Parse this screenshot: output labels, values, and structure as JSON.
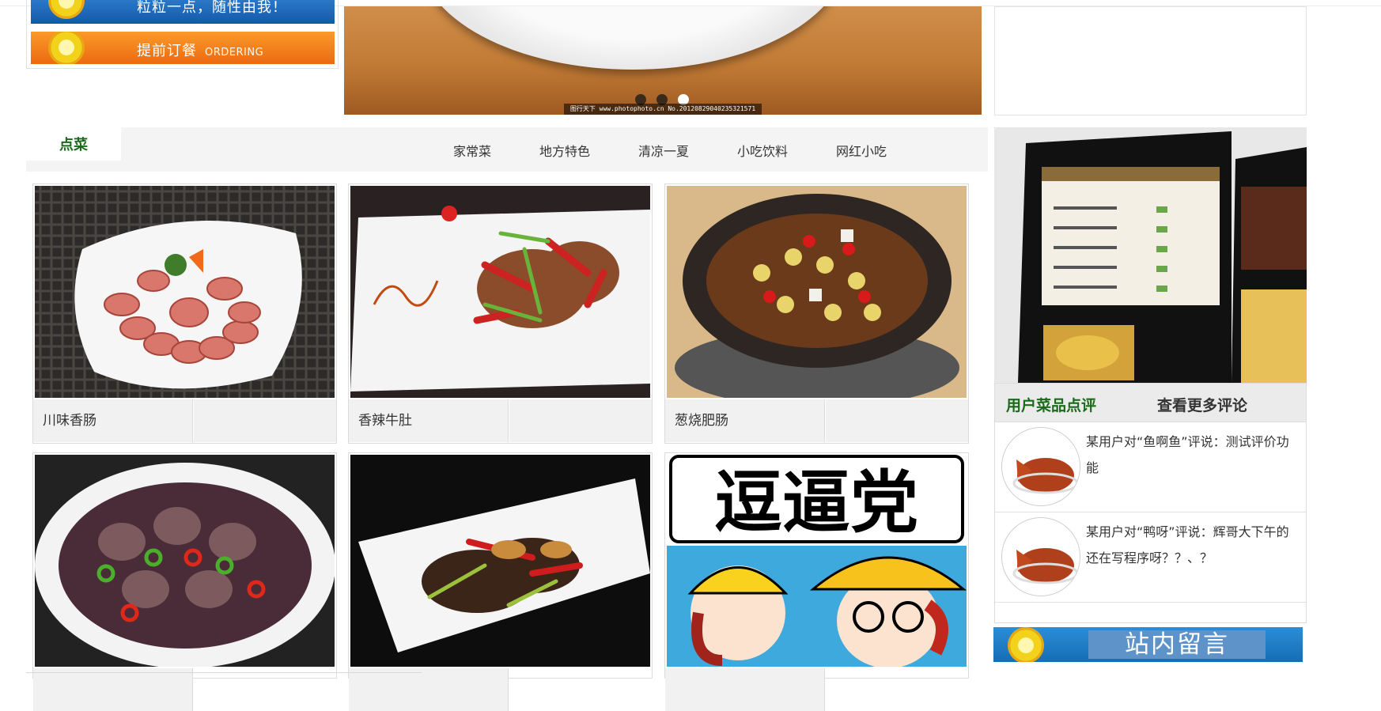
{
  "left_banners": {
    "top_text": "粒粒一点，随性由我！",
    "order_text": "提前订餐",
    "order_en": "ORDERING"
  },
  "carousel": {
    "credit": "图行天下 www.photophoto.cn  No.20120829040235321571",
    "dots": 3,
    "active_dot": 3
  },
  "menu": {
    "tab": "点菜",
    "categories": [
      "家常菜",
      "地方特色",
      "清凉一夏",
      "小吃饮料",
      "网红小吃"
    ]
  },
  "dishes": [
    {
      "name": "川味香肠"
    },
    {
      "name": "香辣牛肚"
    },
    {
      "name": "葱烧肥肠"
    },
    {
      "name": ""
    },
    {
      "name": ""
    },
    {
      "name": "",
      "poster_title": "逗逼党"
    }
  ],
  "reviews": {
    "title": "用户菜品点评",
    "more": "查看更多评论",
    "items": [
      {
        "text": "某用户对“鱼啊鱼”评说：测试评价功能"
      },
      {
        "text": "某用户对“鸭呀”评说：辉哥大下午的还在写程序呀？？、？"
      }
    ]
  },
  "guestbook": {
    "label": "站内留言"
  },
  "colors": {
    "accent_green": "#1b6a1b",
    "banner_blue": "#1459a8",
    "banner_orange": "#ec6a10"
  }
}
